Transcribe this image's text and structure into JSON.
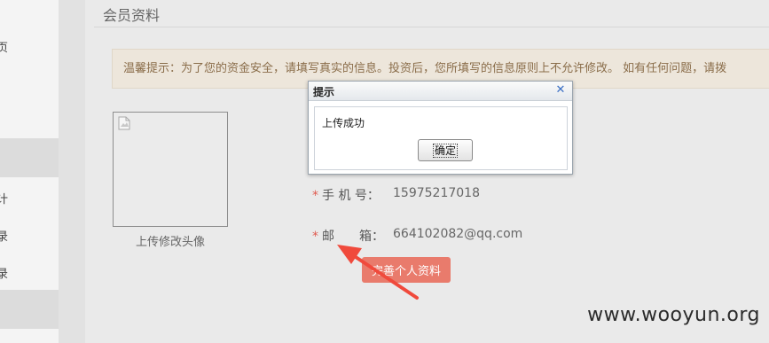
{
  "sidebar": {
    "items": [
      "页",
      "计",
      "录",
      "录"
    ]
  },
  "page": {
    "title": "会员资料",
    "notice": "温馨提示：为了您的资金安全，请填写真实的信息。投资后，您所填写的信息原则上不允许修改。 如有任何问题，请拨"
  },
  "avatar": {
    "caption": "上传修改头像",
    "image_icon": "broken-image-icon"
  },
  "profile": {
    "required_mark": "*",
    "phone_label": "手 机 号：",
    "phone_value": "15975217018",
    "email_label": "邮　　箱：",
    "email_value": "664102082@qq.com",
    "complete_button": "完善个人资料"
  },
  "dialog": {
    "title": "提示",
    "close_icon": "close-icon",
    "message": "上传成功",
    "ok_button": "确定"
  },
  "annotation": {
    "arrow_color": "#f04a3c"
  },
  "watermark": "www.wooyun.org",
  "colors": {
    "accent_button": "#e97b6c",
    "required": "#e05a4f",
    "notice_bg": "#ede6db",
    "notice_text": "#8a6d4a"
  }
}
